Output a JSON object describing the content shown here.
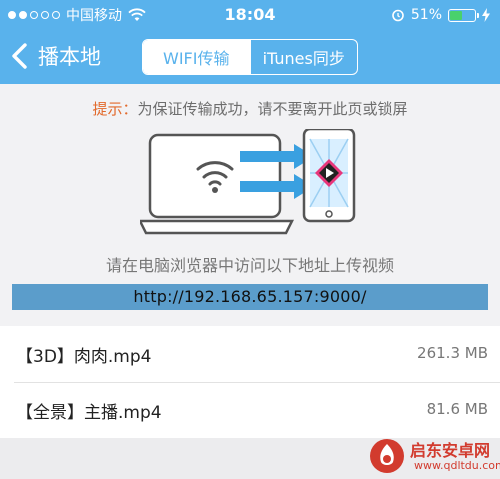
{
  "status_bar": {
    "carrier": "中国移动",
    "time": "18:04",
    "battery_percent": "51%",
    "battery_level": 0.51,
    "icons": [
      "signal-dots-icon",
      "wifi-icon",
      "alarm-icon",
      "battery-icon",
      "charging-icon"
    ]
  },
  "nav": {
    "back_label": "播本地",
    "segments": [
      {
        "label": "WIFI传输",
        "selected": true
      },
      {
        "label": "iTunes同步",
        "selected": false
      }
    ]
  },
  "upload": {
    "tip_key": "提示：",
    "tip_text": "为保证传输成功，请不要离开此页或锁屏",
    "instruction": "请在电脑浏览器中访问以下地址上传视频",
    "url": "http://192.168.65.157:9000/"
  },
  "files": [
    {
      "name": "【3D】肉肉.mp4",
      "size": "261.3 MB"
    },
    {
      "name": "【全景】主播.mp4",
      "size": "81.6 MB"
    }
  ],
  "watermark": {
    "text": "启东安卓网",
    "url": "www.qdltdu.com"
  },
  "colors": {
    "nav_blue": "#59b2ec",
    "tip_orange": "#e26a2c",
    "url_bar": "#5b9dcb",
    "battery_green": "#49d16c",
    "watermark_red": "#d23b2e"
  }
}
